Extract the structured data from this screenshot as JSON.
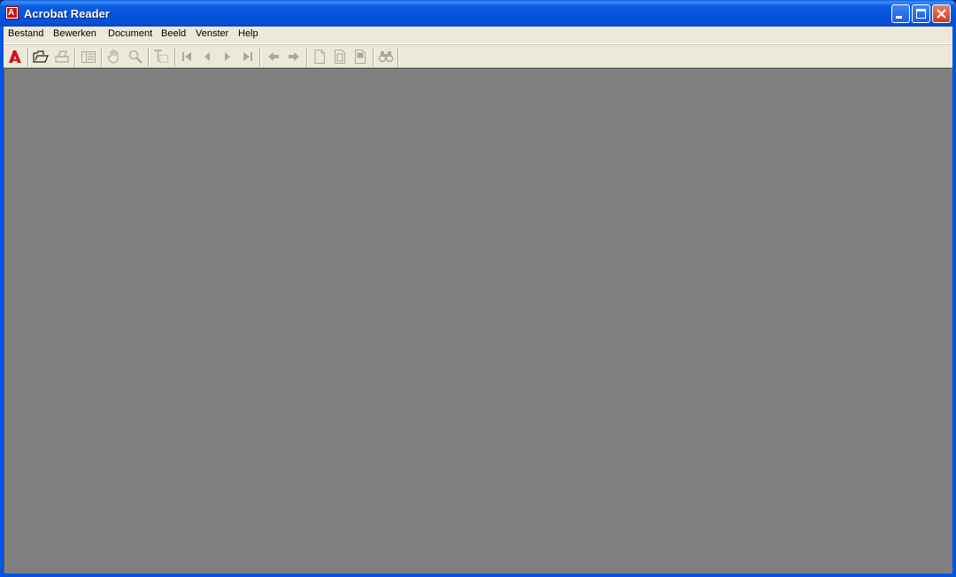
{
  "window": {
    "title": "Acrobat Reader",
    "app_icon_letter": "A"
  },
  "menu": {
    "items": [
      "Bestand",
      "Bewerken",
      "Document",
      "Beeld",
      "Venster",
      "Help"
    ]
  },
  "toolbar": {
    "buttons": [
      {
        "name": "adobe-logo-icon",
        "enabled": true
      },
      {
        "name": "open-folder-icon",
        "enabled": true
      },
      {
        "name": "print-icon",
        "enabled": false
      },
      {
        "name": "show-navigation-pane-icon",
        "enabled": false
      },
      {
        "name": "hand-tool-icon",
        "enabled": false
      },
      {
        "name": "zoom-tool-icon",
        "enabled": false
      },
      {
        "name": "text-select-tool-icon",
        "enabled": false
      },
      {
        "name": "first-page-icon",
        "enabled": false
      },
      {
        "name": "previous-page-icon",
        "enabled": false
      },
      {
        "name": "next-page-icon",
        "enabled": false
      },
      {
        "name": "last-page-icon",
        "enabled": false
      },
      {
        "name": "go-back-icon",
        "enabled": false
      },
      {
        "name": "go-forward-icon",
        "enabled": false
      },
      {
        "name": "actual-size-icon",
        "enabled": false
      },
      {
        "name": "fit-page-icon",
        "enabled": false
      },
      {
        "name": "fit-width-icon",
        "enabled": false
      },
      {
        "name": "find-binoculars-icon",
        "enabled": false
      }
    ]
  },
  "colors": {
    "titlebar": "#0453d9",
    "workspace": "#808080",
    "chrome": "#ece9d8",
    "disabled_icon": "#aca899",
    "adobe_red": "#d0121a"
  }
}
